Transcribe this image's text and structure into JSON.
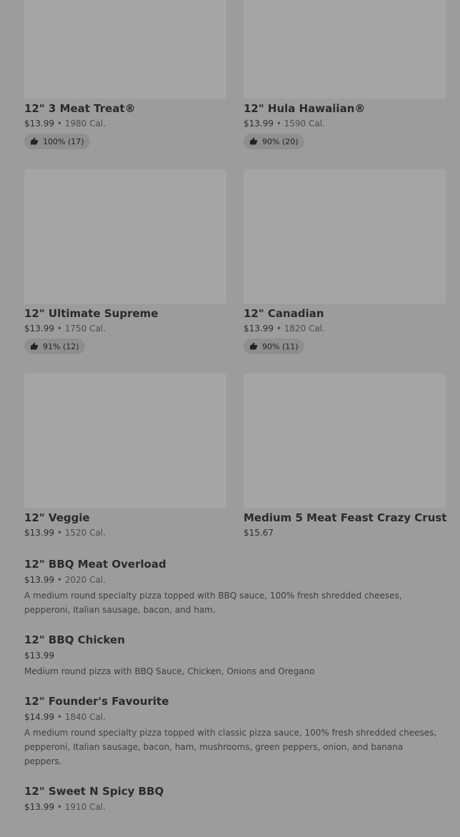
{
  "grid_items": [
    {
      "title": "12\" 3 Meat Treat®",
      "price": "$13.99",
      "sep": " • ",
      "calories": "1980 Cal.",
      "rating": "100% (17)"
    },
    {
      "title": "12\" Hula Hawaiian®",
      "price": "$13.99",
      "sep": " • ",
      "calories": "1590 Cal.",
      "rating": "90% (20)"
    },
    {
      "title": "12\" Ultimate Supreme",
      "price": "$13.99",
      "sep": " • ",
      "calories": "1750 Cal.",
      "rating": "91% (12)"
    },
    {
      "title": "12\" Canadian",
      "price": "$13.99",
      "sep": " • ",
      "calories": "1820 Cal.",
      "rating": "90% (11)"
    },
    {
      "title": "12\" Veggie",
      "price": "$13.99",
      "sep": " • ",
      "calories": "1520 Cal."
    },
    {
      "title": "Medium 5 Meat Feast Crazy Crust",
      "price": "$15.67"
    }
  ],
  "list_items": [
    {
      "title": "12\" BBQ Meat Overload",
      "price": "$13.99",
      "sep": " • ",
      "calories": "2020 Cal.",
      "description": "A medium round specialty pizza topped with BBQ sauce, 100% fresh shredded cheeses, pepperoni, Italian sausage, bacon, and ham."
    },
    {
      "title": "12\" BBQ Chicken",
      "price": "$13.99",
      "description": "Medium round pizza with BBQ Sauce, Chicken, Onions and Oregano"
    },
    {
      "title": "12\" Founder's Favourite",
      "price": "$14.99",
      "sep": " • ",
      "calories": "1840 Cal.",
      "description": "A medium round specialty pizza topped with classic pizza sauce, 100% fresh shredded cheeses, pepperoni, Italian sausage, bacon, ham, mushrooms, green peppers, onion, and banana peppers."
    },
    {
      "title": "12\" Sweet N Spicy BBQ",
      "price": "$13.99",
      "sep": " • ",
      "calories": "1910 Cal."
    }
  ],
  "icons": {
    "rating": "thumbs-up-icon"
  },
  "colors": {
    "background": "#9c9c9c",
    "image_placeholder": "#a5a5a5",
    "rating_pill": "#8e8e8e"
  }
}
